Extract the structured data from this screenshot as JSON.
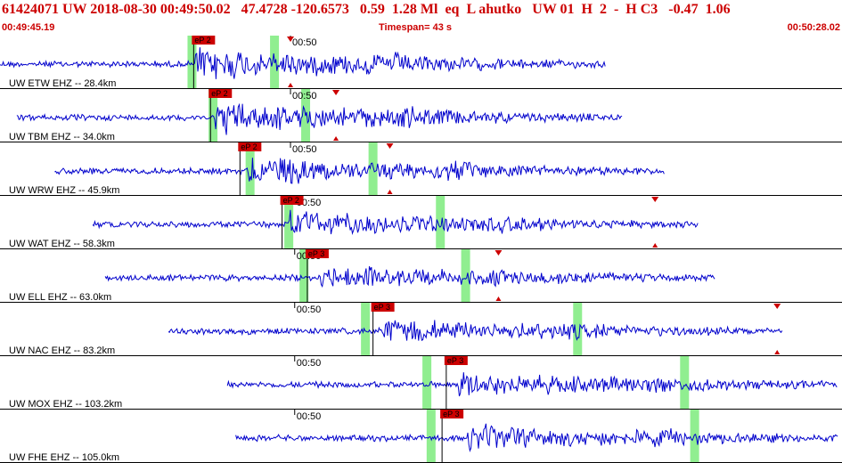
{
  "header": {
    "title": "61424071 UW 2018-08-30 00:49:50.02   47.4728 -120.6573   0.59  1.28 Ml  eq  L ahutko   UW 01  H  2  -  H C3   -0.47  1.06",
    "start_time": "00:49:45.19",
    "timespan": "Timespan=  43 s",
    "end_time": "00:50:28.02"
  },
  "colors": {
    "trace": "#0000cc",
    "pick": "#cc0000",
    "window": "#90ee90",
    "header_text": "#cc0000"
  },
  "traces": [
    {
      "label": "UW ETW EHZ -- 28.4km",
      "tick": "00:50",
      "tick_pos": 0.345,
      "pick": "eP 2",
      "pick_pos": 0.23,
      "start": 0.0,
      "end": 0.72,
      "onset": 0.232,
      "amp": 0.85,
      "green": [
        0.228,
        0.326
      ],
      "marker": 0.345
    },
    {
      "label": "UW TBM EHZ -- 34.0km",
      "tick": "00:50",
      "tick_pos": 0.345,
      "pick": "eP 2",
      "pick_pos": 0.25,
      "start": 0.02,
      "end": 0.74,
      "onset": 0.255,
      "amp": 0.75,
      "green": [
        0.253,
        0.363
      ],
      "marker": 0.399
    },
    {
      "label": "UW WRW EHZ -- 45.9km",
      "tick": "00:50",
      "tick_pos": 0.345,
      "pick": "eP 2",
      "pick_pos": 0.285,
      "start": 0.065,
      "end": 0.79,
      "onset": 0.295,
      "amp": 0.7,
      "green": [
        0.297,
        0.443
      ],
      "marker": 0.463
    },
    {
      "label": "UW WAT EHZ -- 58.3km",
      "tick": "00:50",
      "tick_pos": 0.35,
      "pick": "eP 2",
      "pick_pos": 0.335,
      "start": 0.11,
      "end": 0.83,
      "onset": 0.343,
      "amp": 0.6,
      "green": [
        0.343,
        0.523
      ],
      "marker": 0.778
    },
    {
      "label": "UW ELL EHZ -- 63.0km",
      "tick": "00:50",
      "tick_pos": 0.35,
      "pick": "eP 3",
      "pick_pos": 0.365,
      "start": 0.125,
      "end": 0.85,
      "onset": 0.378,
      "amp": 0.55,
      "green": [
        0.361,
        0.553
      ],
      "marker": 0.592
    },
    {
      "label": "UW NAC EHZ -- 83.2km",
      "tick": "00:50",
      "tick_pos": 0.35,
      "pick": "eP 3",
      "pick_pos": 0.443,
      "start": 0.2,
      "end": 0.93,
      "onset": 0.455,
      "amp": 0.55,
      "green": [
        0.434,
        0.686
      ],
      "marker": 0.923
    },
    {
      "label": "UW MOX EHZ -- 103.2km",
      "tick": "00:50",
      "tick_pos": 0.35,
      "pick": "eP 3",
      "pick_pos": 0.53,
      "start": 0.27,
      "end": 0.995,
      "onset": 0.545,
      "amp": 0.55,
      "green": [
        0.507,
        0.813
      ],
      "marker": null
    },
    {
      "label": "UW FHE EHZ -- 105.0km",
      "tick": "00:50",
      "tick_pos": 0.35,
      "pick": "eP 3",
      "pick_pos": 0.525,
      "start": 0.28,
      "end": 0.995,
      "onset": 0.555,
      "amp": 0.55,
      "green": [
        0.512,
        0.825
      ],
      "marker": null
    }
  ]
}
